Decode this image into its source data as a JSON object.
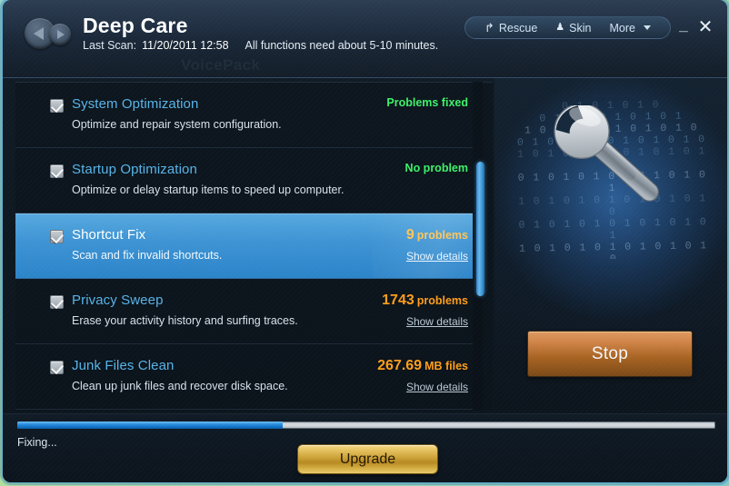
{
  "window": {
    "title": "Deep Care",
    "last_scan_label": "Last Scan:",
    "last_scan_value": "11/20/2011 12:58",
    "hint": "All functions need about 5-10 minutes.",
    "watermark": "VoicePack",
    "minimize_label": "_",
    "close_label": "✕",
    "nav_back_icon": "back-arrow-icon",
    "nav_forward_icon": "forward-arrow-icon"
  },
  "header_buttons": {
    "rescue": {
      "label": "Rescue",
      "icon": "↰"
    },
    "skin": {
      "label": "Skin",
      "icon": "♟"
    },
    "more": {
      "label": "More"
    }
  },
  "list": [
    {
      "title": "System Optimization",
      "description": "Optimize and repair system configuration.",
      "checked": true,
      "selected": false,
      "status_kind": "text",
      "status_text": "Problems fixed",
      "number": "",
      "unit": "",
      "details_label": ""
    },
    {
      "title": "Startup Optimization",
      "description": "Optimize or delay startup items to speed up computer.",
      "checked": true,
      "selected": false,
      "status_kind": "text",
      "status_text": "No problem",
      "number": "",
      "unit": "",
      "details_label": ""
    },
    {
      "title": "Shortcut Fix",
      "description": "Scan and fix invalid shortcuts.",
      "checked": true,
      "selected": true,
      "status_kind": "count",
      "status_text": "",
      "number": "9",
      "unit": "problems",
      "details_label": "Show details"
    },
    {
      "title": "Privacy Sweep",
      "description": "Erase your activity history and surfing traces.",
      "checked": true,
      "selected": false,
      "status_kind": "count",
      "status_text": "",
      "number": "1743",
      "unit": "problems",
      "details_label": "Show details"
    },
    {
      "title": "Junk Files Clean",
      "description": "Clean up junk files and recover disk space.",
      "checked": true,
      "selected": false,
      "status_kind": "count",
      "status_text": "",
      "number": "267.69",
      "unit": "MB files",
      "details_label": "Show details"
    }
  ],
  "right_panel": {
    "stop_label": "Stop",
    "wrench_icon": "wrench-icon",
    "binary_rows": [
      "0 1 0 1 0 1 0",
      "0 1 0 1 0 1 0 1 0 1",
      "1 0 1 0 1 0 1 0 1 0 1 0",
      "0 1 0 1 0 1 0 1 0 1 0 1 0",
      "1 0 1 0 1 0 1 0 1 0 1 0 1 0",
      "0 1 0 1 0 1 0 1 0 1 0 1 0 1",
      "1 0 1 0 1 0 1 0 1 0 1 0 1 0",
      "0 1 0 1 0 1 0 1 0 1 0 1 0 1",
      "1 0 1 0 1 0 1 0 1 0 1 0 1 0",
      "0 1 0 1 0 1 0 1 0 1 0 1 0",
      "1 0 1 0 1 0 1 0 1 0 1 0",
      "0 1 0 1 0 1 0 1 0 1",
      "1 0 1 0 1 0 1 0"
    ]
  },
  "footer": {
    "status": "Fixing...",
    "progress_percent": 38,
    "upgrade_label": "Upgrade"
  },
  "colors": {
    "accent_blue": "#2d8ede",
    "selected_row": "#3d93d3",
    "title_blue": "#57b4e8",
    "status_green": "#3ff06a",
    "status_orange": "#ff9e1b",
    "stop_button": "#a86423",
    "upgrade_button": "#caa137"
  }
}
